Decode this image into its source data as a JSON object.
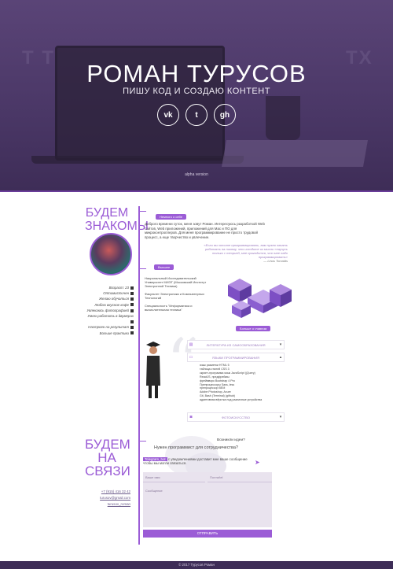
{
  "hero": {
    "title": "РОМАН ТУРУСОВ",
    "subtitle": "ПИШУ КОД И СОЗДАЮ КОНТЕНТ",
    "socials": [
      {
        "icon": "vk-icon",
        "glyph": "vk"
      },
      {
        "icon": "twitter-icon",
        "glyph": "t"
      },
      {
        "icon": "github-icon",
        "glyph": "gh"
      }
    ],
    "version": "alpha version"
  },
  "about": {
    "heading_line1": "БУДЕМ",
    "heading_line2": "ЗНАКОМЫ",
    "tag": "Немного о себе",
    "text": "Доброго времени суток, меня зовут Роман. Интересуюсь разработкой Web сайтов, Web приложений, приложений для Mac и ПО для микроконтроллеров. Для меня программирование не просто трудовой процесс, а еще творчество и увлечение.",
    "quote": "«Если вы хотите программировать, вам нужно начать работать на никому, что исходите из мысли «научусь только с теорией, мне пригодится, что мне надо программировать»",
    "quote_author": "— Linus Torvalds",
    "facts": [
      "Возраст: 23",
      "Оптимистичен",
      "Желаю обучаться",
      "Люблю вкусное кофе",
      "Увлекаюсь фотографией",
      "Умею работать в двумерах",
      "Настроен на результат",
      "Больше практики"
    ]
  },
  "education": {
    "tag": "Высшее",
    "text_1": "Национальный Исследовательский Университет МИЭТ (Московский Институт Электронной Техники)",
    "text_2": "Факультет Электроники и Компьютерных Технологий",
    "text_3": "Специальность \"Информатика и вычислительная техника\"",
    "more_button": "Больше о главном",
    "accordion": [
      {
        "icon": "book-icon",
        "label": "ЛИТЕРАТУРА ИЗ САМООБРАЗОВАНИЯ"
      },
      {
        "icon": "monitor-icon",
        "label": "ЯЗЫКИ ПРОГРАММИРОВАНИЯ"
      },
      {
        "icon": "camera-icon",
        "label": "ФОТОИСКУССТВО"
      }
    ],
    "skills": [
      "язык разметки HTML 5",
      "таблица стилей CSS 3",
      "скрипт-программа язык JavaScript (jQuery)",
      "ReactJS, предфреймы",
      "фреймворк Bootstrap 4 Pro",
      "Препроцессоры Sass, less",
      "препроцессор BEM",
      "Adobe Photoshop, Axure",
      "Git, Bash (Terminal) (github)",
      "адаптивная вёрстка под различные устройства"
    ]
  },
  "contact": {
    "heading_line1": "БУДЕМ",
    "heading_line2": "НА",
    "heading_line3": "СВЯЗИ",
    "contacts": [
      "+7 (915) 416 32 42",
      "turusov@gmail.com",
      "turusov_roman"
    ],
    "question_1": "Возникли идеи?",
    "question_2": "Нужен программист для сотрудничества?",
    "telegram_tag": "Telegram_bot",
    "telegram_text": "с уведомлениями доставит мне ваше сообщение чтобы мы могли связаться.",
    "name_placeholder": "Ваше имя",
    "email_placeholder": "Почта/tel",
    "message_placeholder": "Сообщение",
    "send_button": "ОТПРАВИТЬ"
  },
  "footer": {
    "copyright": "© 2017 Турусов Роман"
  }
}
